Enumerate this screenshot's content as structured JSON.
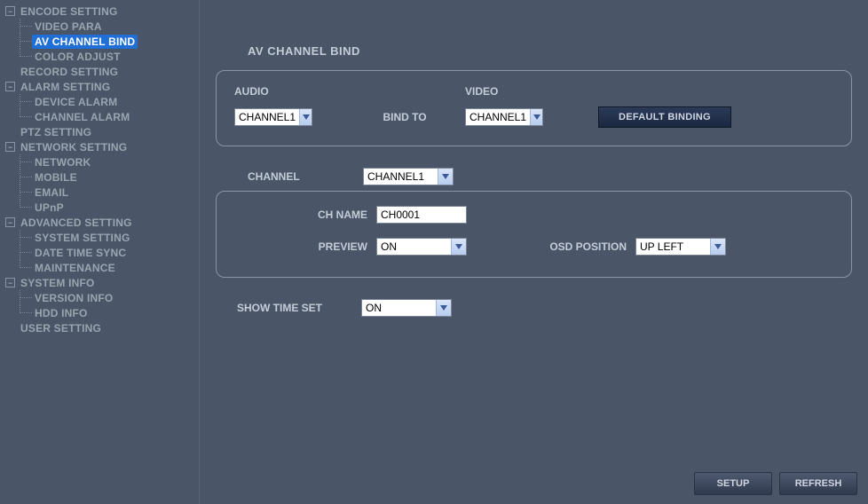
{
  "sidebar": {
    "items": [
      {
        "label": "ENCODE SETTING",
        "type": "group",
        "toggle": "minus",
        "children": [
          {
            "label": "VIDEO PARA"
          },
          {
            "label": "AV CHANNEL BIND",
            "selected": true
          },
          {
            "label": "COLOR ADJUST"
          }
        ]
      },
      {
        "label": "RECORD SETTING",
        "type": "item"
      },
      {
        "label": "ALARM SETTING",
        "type": "group",
        "toggle": "minus",
        "children": [
          {
            "label": "DEVICE ALARM"
          },
          {
            "label": "CHANNEL ALARM"
          }
        ]
      },
      {
        "label": "PTZ SETTING",
        "type": "item"
      },
      {
        "label": "NETWORK SETTING",
        "type": "group",
        "toggle": "minus",
        "children": [
          {
            "label": "NETWORK"
          },
          {
            "label": "MOBILE"
          },
          {
            "label": "EMAIL"
          },
          {
            "label": "UPnP"
          }
        ]
      },
      {
        "label": "ADVANCED SETTING",
        "type": "group",
        "toggle": "minus",
        "children": [
          {
            "label": "SYSTEM SETTING"
          },
          {
            "label": "DATE TIME SYNC"
          },
          {
            "label": "MAINTENANCE"
          }
        ]
      },
      {
        "label": "SYSTEM INFO",
        "type": "group",
        "toggle": "minus",
        "children": [
          {
            "label": "VERSION INFO"
          },
          {
            "label": "HDD INFO"
          }
        ]
      },
      {
        "label": "USER SETTING",
        "type": "item"
      }
    ]
  },
  "main": {
    "title": "AV CHANNEL BIND",
    "bind_group": {
      "audio_label": "AUDIO",
      "audio_value": "CHANNEL1",
      "bind_to_label": "BIND TO",
      "video_label": "VIDEO",
      "video_value": "CHANNEL1",
      "default_btn": "DEFAULT BINDING"
    },
    "channel_label": "CHANNEL",
    "channel_value": "CHANNEL1",
    "ch_group": {
      "ch_name_label": "CH NAME",
      "ch_name_value": "CH0001",
      "preview_label": "PREVIEW",
      "preview_value": "ON",
      "osd_label": "OSD POSITION",
      "osd_value": "UP LEFT"
    },
    "showtime_label": "SHOW TIME SET",
    "showtime_value": "ON",
    "footer": {
      "setup": "SETUP",
      "refresh": "REFRESH"
    }
  }
}
